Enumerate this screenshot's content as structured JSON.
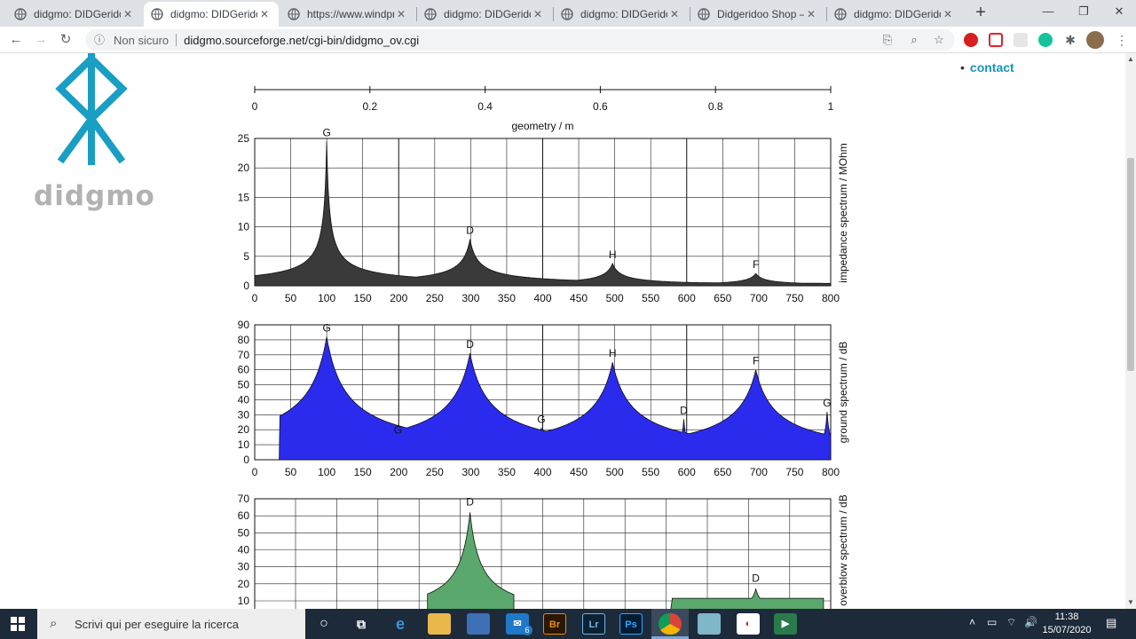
{
  "browser": {
    "tabs": [
      {
        "title": "didgmo: DIDGeridoo Modeller",
        "active": false
      },
      {
        "title": "didgmo: DIDGeridoo Modeller",
        "active": true
      },
      {
        "title": "https://www.windproject.org",
        "active": false
      },
      {
        "title": "didgmo: DIDGeridoo Modeller",
        "active": false
      },
      {
        "title": "didgmo: DIDGeridoo Modeller",
        "active": false
      },
      {
        "title": "Didgeridoo Shop – Didgeridoos",
        "active": false
      },
      {
        "title": "didgmo: DIDGeridoo Modeller",
        "active": false
      }
    ],
    "security_label": "Non sicuro",
    "url": "didgmo.sourceforge.net/cgi-bin/didgmo_ov.cgi"
  },
  "page": {
    "logo_text": "didgmo",
    "nav_link": "contact",
    "logo_color": "#1a9ec4"
  },
  "chart_data": [
    {
      "type": "area",
      "title": "",
      "xlabel": "geometry / m",
      "ylabel": "",
      "xlim": [
        0,
        1
      ],
      "x_ticks": [
        "0",
        "0.2",
        "0.4",
        "0.6",
        "0.8",
        "1"
      ],
      "note": "geometry axis strip"
    },
    {
      "type": "area",
      "title": "",
      "ylabel": "impedance spectrum / MOhm",
      "xlim": [
        0,
        800
      ],
      "ylim": [
        0,
        25
      ],
      "x_ticks": [
        "0",
        "50",
        "100",
        "150",
        "200",
        "250",
        "300",
        "350",
        "400",
        "450",
        "500",
        "550",
        "600",
        "650",
        "700",
        "750",
        "800"
      ],
      "y_ticks": [
        "0",
        "5",
        "10",
        "15",
        "20",
        "25"
      ],
      "color": "#3a3a3a",
      "peaks": [
        {
          "x": 100,
          "y": 24.5,
          "label": "G"
        },
        {
          "x": 299,
          "y": 7.9,
          "label": "D"
        },
        {
          "x": 497,
          "y": 3.8,
          "label": "H"
        },
        {
          "x": 696,
          "y": 2.1,
          "label": "F"
        }
      ]
    },
    {
      "type": "area",
      "title": "",
      "ylabel": "ground spectrum / dB",
      "xlim": [
        0,
        800
      ],
      "ylim": [
        0,
        90
      ],
      "x_ticks": [
        "0",
        "50",
        "100",
        "150",
        "200",
        "250",
        "300",
        "350",
        "400",
        "450",
        "500",
        "550",
        "600",
        "650",
        "700",
        "750",
        "800"
      ],
      "y_ticks": [
        "0",
        "10",
        "20",
        "30",
        "40",
        "50",
        "60",
        "70",
        "80",
        "90"
      ],
      "color": "#2b2bee",
      "peaks": [
        {
          "x": 100,
          "y": 82,
          "label": "G"
        },
        {
          "x": 199,
          "y": 14,
          "label": "G"
        },
        {
          "x": 299,
          "y": 71,
          "label": "D"
        },
        {
          "x": 398,
          "y": 21,
          "label": "G"
        },
        {
          "x": 497,
          "y": 65,
          "label": "H"
        },
        {
          "x": 596,
          "y": 27,
          "label": "D"
        },
        {
          "x": 696,
          "y": 60,
          "label": "F"
        },
        {
          "x": 795,
          "y": 32,
          "label": "G"
        }
      ]
    },
    {
      "type": "area",
      "title": "",
      "ylabel": "overblow spectrum / dB",
      "ylim": [
        0,
        70
      ],
      "y_ticks": [
        "10",
        "20",
        "30",
        "40",
        "50",
        "60",
        "70"
      ],
      "color": "#5aa86b",
      "peaks": [
        {
          "x": 299,
          "y": 62,
          "label": "D"
        },
        {
          "x": 696,
          "y": 17,
          "label": "D"
        }
      ]
    }
  ],
  "taskbar": {
    "search_placeholder": "Scrivi qui per eseguire la ricerca",
    "mail_badge": "6",
    "time": "11:38",
    "date": "15/07/2020"
  }
}
